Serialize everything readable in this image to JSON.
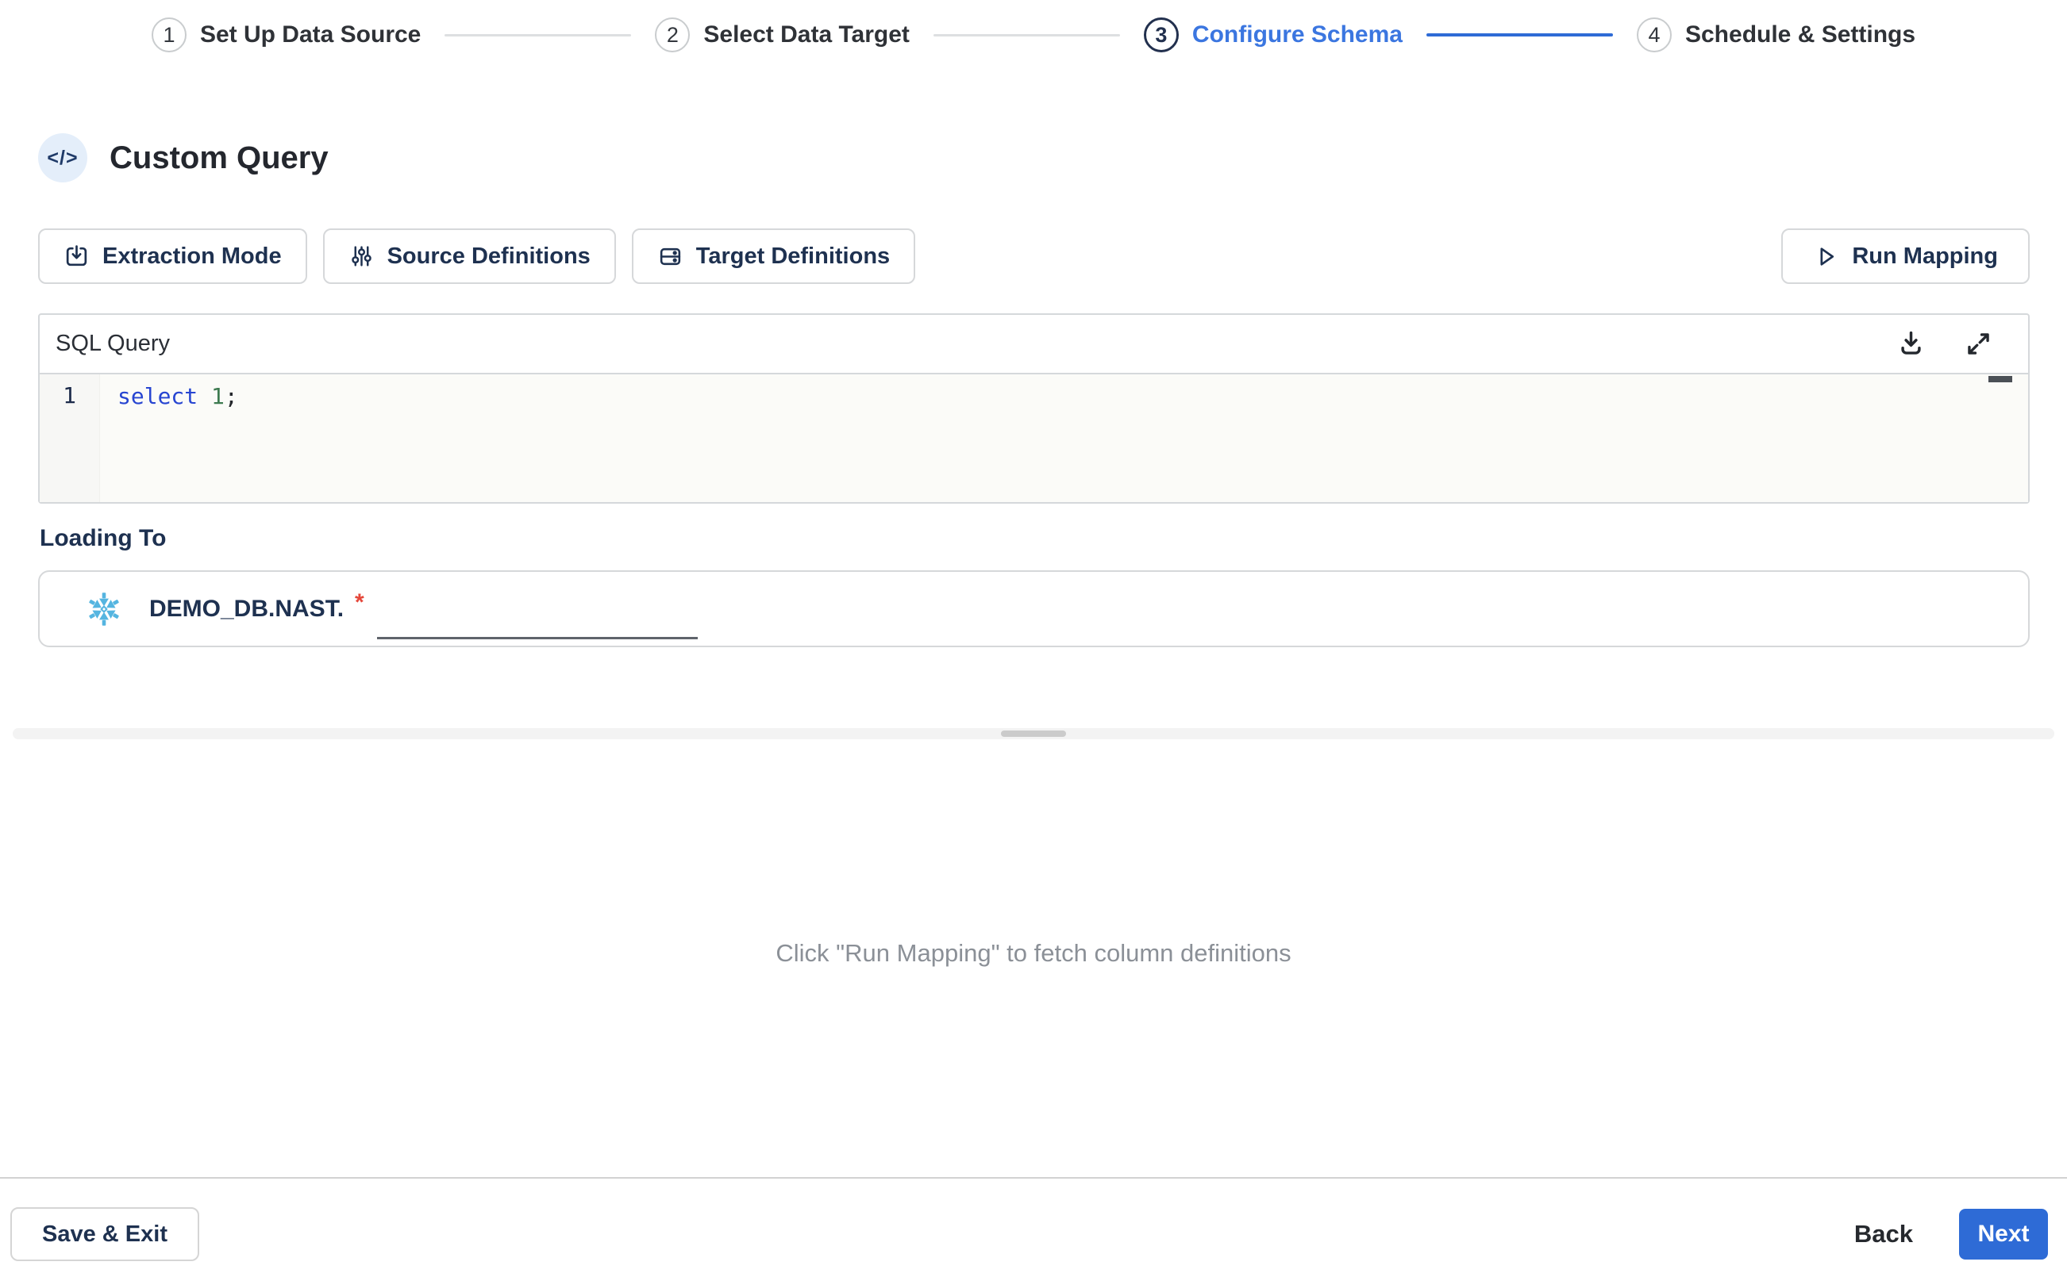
{
  "stepper": {
    "steps": [
      {
        "number": "1",
        "label": "Set Up Data Source"
      },
      {
        "number": "2",
        "label": "Select Data Target"
      },
      {
        "number": "3",
        "label": "Configure Schema"
      },
      {
        "number": "4",
        "label": "Schedule & Settings"
      }
    ]
  },
  "header": {
    "title": "Custom Query",
    "icon_glyph": "</>"
  },
  "toolbar": {
    "extraction_mode": "Extraction Mode",
    "source_definitions": "Source Definitions",
    "target_definitions": "Target Definitions",
    "run_mapping": "Run Mapping"
  },
  "sql_editor": {
    "title": "SQL Query",
    "line_number": "1",
    "tokens": {
      "keyword": "select ",
      "number": "1",
      "punctuation": ";"
    }
  },
  "loading_to": {
    "section_label": "Loading To",
    "destination_prefix": "DEMO_DB.NAST.",
    "required_marker": "*",
    "table_name_value": ""
  },
  "hint": {
    "text": "Click \"Run Mapping\" to fetch column definitions"
  },
  "footer": {
    "save_exit": "Save & Exit",
    "back": "Back",
    "next": "Next"
  },
  "icons": {
    "header_icon": "code-icon",
    "extraction_mode_icon": "download-box-icon",
    "source_definitions_icon": "sliders-icon",
    "target_definitions_icon": "database-icon",
    "run_mapping_icon": "play-icon",
    "sql_download_icon": "download-icon",
    "sql_expand_icon": "expand-icon",
    "loading_icon": "snowflake-icon"
  },
  "colors": {
    "accent_blue": "#2e6bd6",
    "active_step_blue": "#3b76e0",
    "navy_text": "#1e3150",
    "keyword_blue": "#2745d1",
    "number_green": "#3d7a50",
    "required_red": "#e5473a",
    "snowflake_blue": "#55b5e0"
  }
}
